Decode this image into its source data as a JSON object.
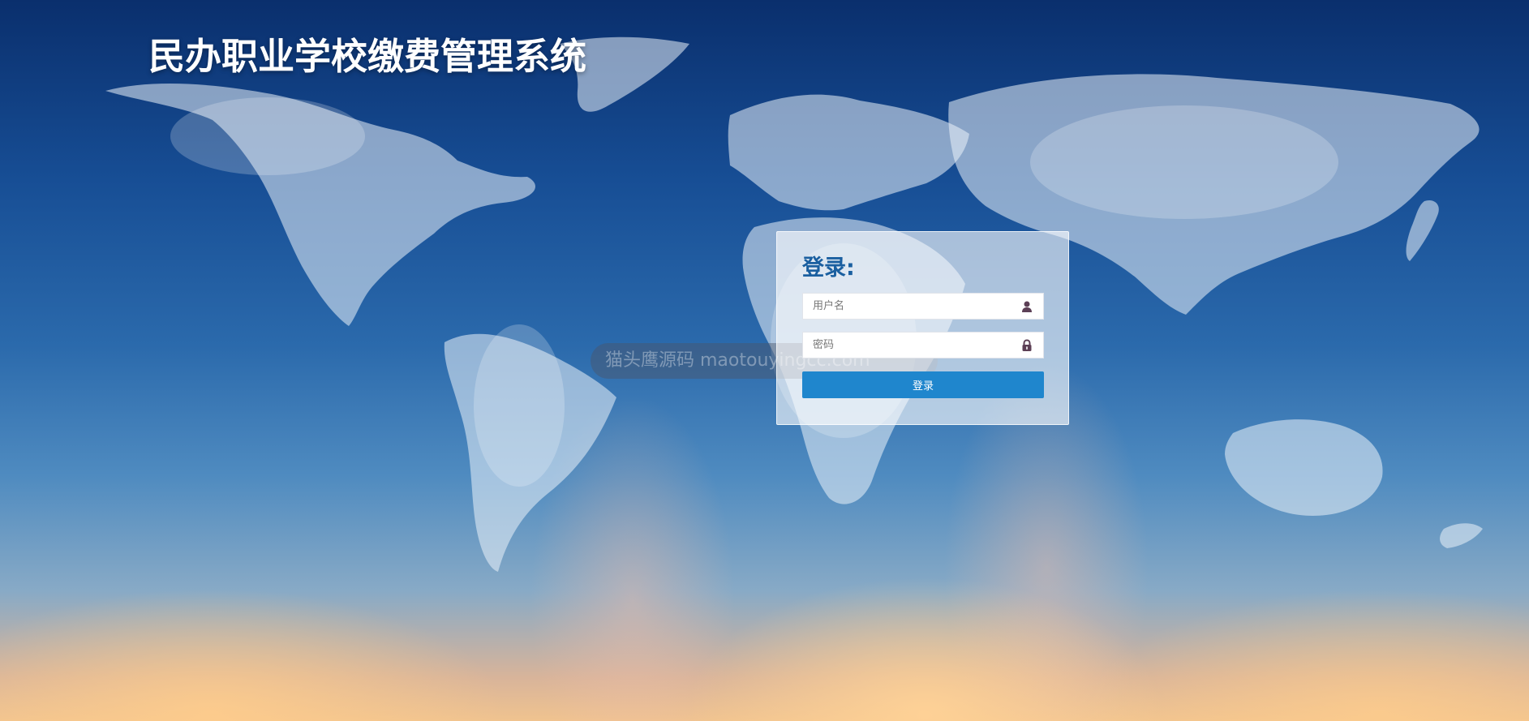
{
  "header": {
    "title": "民办职业学校缴费管理系统"
  },
  "login": {
    "title": "登录:",
    "username_placeholder": "用户名",
    "password_placeholder": "密码",
    "submit_label": "登录"
  },
  "watermark": {
    "text": "猫头鹰源码 maotouyingcc.com"
  },
  "icons": {
    "username": "user-icon",
    "password": "lock-icon"
  },
  "colors": {
    "title_text": "#ffffff",
    "login_heading": "#1a5fa0",
    "button": "#1f86cd",
    "icon": "#5c3f55"
  }
}
